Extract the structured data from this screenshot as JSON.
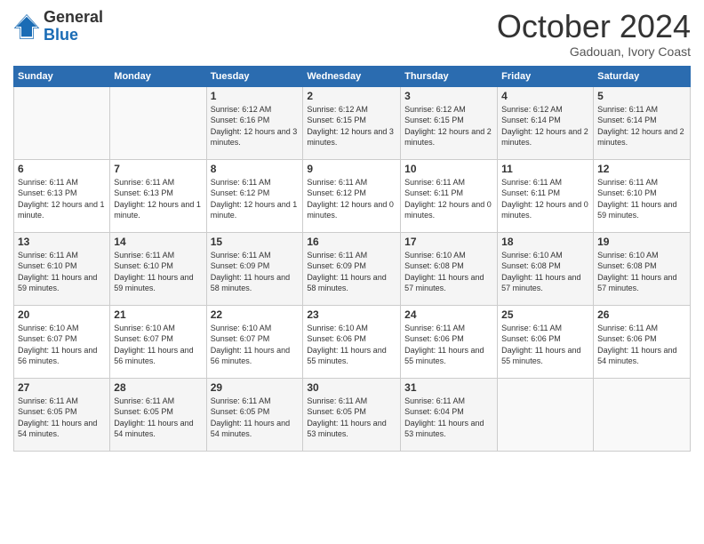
{
  "header": {
    "logo_general": "General",
    "logo_blue": "Blue",
    "month_title": "October 2024",
    "subtitle": "Gadouan, Ivory Coast"
  },
  "days_of_week": [
    "Sunday",
    "Monday",
    "Tuesday",
    "Wednesday",
    "Thursday",
    "Friday",
    "Saturday"
  ],
  "weeks": [
    [
      {
        "day": "",
        "info": ""
      },
      {
        "day": "",
        "info": ""
      },
      {
        "day": "1",
        "info": "Sunrise: 6:12 AM\nSunset: 6:16 PM\nDaylight: 12 hours and 3 minutes."
      },
      {
        "day": "2",
        "info": "Sunrise: 6:12 AM\nSunset: 6:15 PM\nDaylight: 12 hours and 3 minutes."
      },
      {
        "day": "3",
        "info": "Sunrise: 6:12 AM\nSunset: 6:15 PM\nDaylight: 12 hours and 2 minutes."
      },
      {
        "day": "4",
        "info": "Sunrise: 6:12 AM\nSunset: 6:14 PM\nDaylight: 12 hours and 2 minutes."
      },
      {
        "day": "5",
        "info": "Sunrise: 6:11 AM\nSunset: 6:14 PM\nDaylight: 12 hours and 2 minutes."
      }
    ],
    [
      {
        "day": "6",
        "info": "Sunrise: 6:11 AM\nSunset: 6:13 PM\nDaylight: 12 hours and 1 minute."
      },
      {
        "day": "7",
        "info": "Sunrise: 6:11 AM\nSunset: 6:13 PM\nDaylight: 12 hours and 1 minute."
      },
      {
        "day": "8",
        "info": "Sunrise: 6:11 AM\nSunset: 6:12 PM\nDaylight: 12 hours and 1 minute."
      },
      {
        "day": "9",
        "info": "Sunrise: 6:11 AM\nSunset: 6:12 PM\nDaylight: 12 hours and 0 minutes."
      },
      {
        "day": "10",
        "info": "Sunrise: 6:11 AM\nSunset: 6:11 PM\nDaylight: 12 hours and 0 minutes."
      },
      {
        "day": "11",
        "info": "Sunrise: 6:11 AM\nSunset: 6:11 PM\nDaylight: 12 hours and 0 minutes."
      },
      {
        "day": "12",
        "info": "Sunrise: 6:11 AM\nSunset: 6:10 PM\nDaylight: 11 hours and 59 minutes."
      }
    ],
    [
      {
        "day": "13",
        "info": "Sunrise: 6:11 AM\nSunset: 6:10 PM\nDaylight: 11 hours and 59 minutes."
      },
      {
        "day": "14",
        "info": "Sunrise: 6:11 AM\nSunset: 6:10 PM\nDaylight: 11 hours and 59 minutes."
      },
      {
        "day": "15",
        "info": "Sunrise: 6:11 AM\nSunset: 6:09 PM\nDaylight: 11 hours and 58 minutes."
      },
      {
        "day": "16",
        "info": "Sunrise: 6:11 AM\nSunset: 6:09 PM\nDaylight: 11 hours and 58 minutes."
      },
      {
        "day": "17",
        "info": "Sunrise: 6:10 AM\nSunset: 6:08 PM\nDaylight: 11 hours and 57 minutes."
      },
      {
        "day": "18",
        "info": "Sunrise: 6:10 AM\nSunset: 6:08 PM\nDaylight: 11 hours and 57 minutes."
      },
      {
        "day": "19",
        "info": "Sunrise: 6:10 AM\nSunset: 6:08 PM\nDaylight: 11 hours and 57 minutes."
      }
    ],
    [
      {
        "day": "20",
        "info": "Sunrise: 6:10 AM\nSunset: 6:07 PM\nDaylight: 11 hours and 56 minutes."
      },
      {
        "day": "21",
        "info": "Sunrise: 6:10 AM\nSunset: 6:07 PM\nDaylight: 11 hours and 56 minutes."
      },
      {
        "day": "22",
        "info": "Sunrise: 6:10 AM\nSunset: 6:07 PM\nDaylight: 11 hours and 56 minutes."
      },
      {
        "day": "23",
        "info": "Sunrise: 6:10 AM\nSunset: 6:06 PM\nDaylight: 11 hours and 55 minutes."
      },
      {
        "day": "24",
        "info": "Sunrise: 6:11 AM\nSunset: 6:06 PM\nDaylight: 11 hours and 55 minutes."
      },
      {
        "day": "25",
        "info": "Sunrise: 6:11 AM\nSunset: 6:06 PM\nDaylight: 11 hours and 55 minutes."
      },
      {
        "day": "26",
        "info": "Sunrise: 6:11 AM\nSunset: 6:06 PM\nDaylight: 11 hours and 54 minutes."
      }
    ],
    [
      {
        "day": "27",
        "info": "Sunrise: 6:11 AM\nSunset: 6:05 PM\nDaylight: 11 hours and 54 minutes."
      },
      {
        "day": "28",
        "info": "Sunrise: 6:11 AM\nSunset: 6:05 PM\nDaylight: 11 hours and 54 minutes."
      },
      {
        "day": "29",
        "info": "Sunrise: 6:11 AM\nSunset: 6:05 PM\nDaylight: 11 hours and 54 minutes."
      },
      {
        "day": "30",
        "info": "Sunrise: 6:11 AM\nSunset: 6:05 PM\nDaylight: 11 hours and 53 minutes."
      },
      {
        "day": "31",
        "info": "Sunrise: 6:11 AM\nSunset: 6:04 PM\nDaylight: 11 hours and 53 minutes."
      },
      {
        "day": "",
        "info": ""
      },
      {
        "day": "",
        "info": ""
      }
    ]
  ]
}
